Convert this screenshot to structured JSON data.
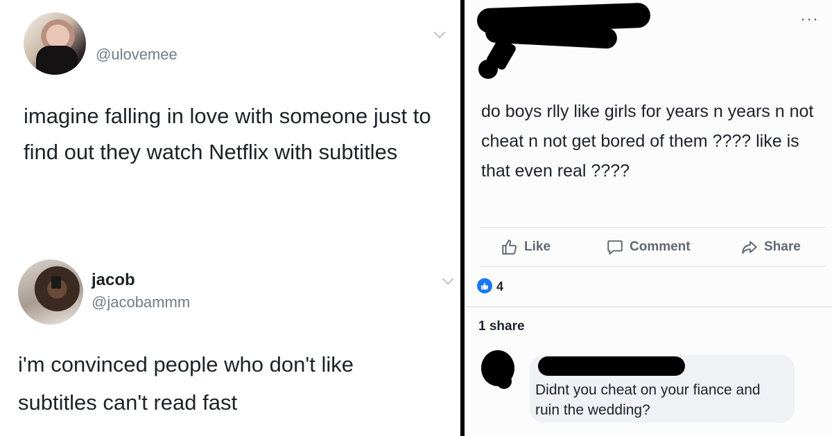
{
  "left": {
    "tweet1": {
      "handle": "@ulovemee",
      "text": "imagine falling in love with someone just to find out they watch Netflix with subtitles"
    },
    "tweet2": {
      "name": "jacob",
      "handle": "@jacobammm",
      "text": "i'm convinced people who don't like subtitles can't read fast"
    }
  },
  "right": {
    "more": "···",
    "post_text": "do boys rlly like girls for years n years n not cheat n not get bored of them ???? like is that even real ????",
    "actions": {
      "like": "Like",
      "comment": "Comment",
      "share": "Share"
    },
    "reaction_count": "4",
    "shares": "1 share",
    "comment_text": "Didnt you cheat on your fiance and ruin the wedding?"
  },
  "colors": {
    "facebook_blue": "#1877f2",
    "twitter_gray": "#6f7b85"
  }
}
